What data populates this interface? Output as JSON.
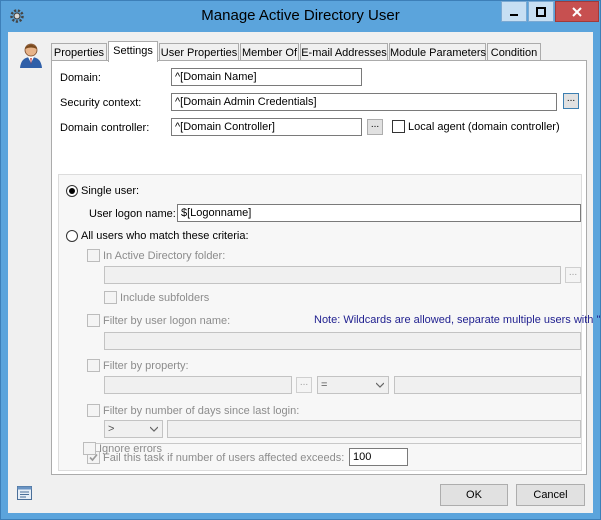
{
  "window": {
    "title": "Manage Active Directory User"
  },
  "tabs": [
    {
      "label": "Properties",
      "active": false
    },
    {
      "label": "Settings",
      "active": true
    },
    {
      "label": "User Properties",
      "active": false
    },
    {
      "label": "Member Of",
      "active": false
    },
    {
      "label": "E-mail Addresses",
      "active": false
    },
    {
      "label": "Module Parameters",
      "active": false
    },
    {
      "label": "Condition",
      "active": false
    }
  ],
  "settings": {
    "domain_label": "Domain:",
    "domain_value": "^[Domain Name]",
    "security_label": "Security context:",
    "security_value": "^[Domain Admin Credentials]",
    "dc_label": "Domain controller:",
    "dc_value": "^[Domain Controller]",
    "browse_label": "...",
    "local_agent_label": "Local agent (domain controller)",
    "single_user_label": "Single user:",
    "logon_label": "User logon name:",
    "logon_value": "$[Logonname]",
    "all_users_label": "All users who match these criteria:",
    "ad_folder_label": "In Active Directory folder:",
    "ad_folder_value": "",
    "include_sub_label": "Include subfolders",
    "filter_logon_label": "Filter by user logon name:",
    "wildcard_note": "Note: Wildcards are allowed, separate multiple users with \";\".",
    "filter_logon_value": "",
    "filter_prop_label": "Filter by property:",
    "prop_operator": "=",
    "filter_days_label": "Filter by number of days since last login:",
    "days_operator": ">",
    "fail_label": "Fail this task if number of users affected exceeds:",
    "fail_value": "100",
    "ignore_errors_label": "Ignore errors"
  },
  "footer": {
    "ok_label": "OK",
    "cancel_label": "Cancel"
  }
}
